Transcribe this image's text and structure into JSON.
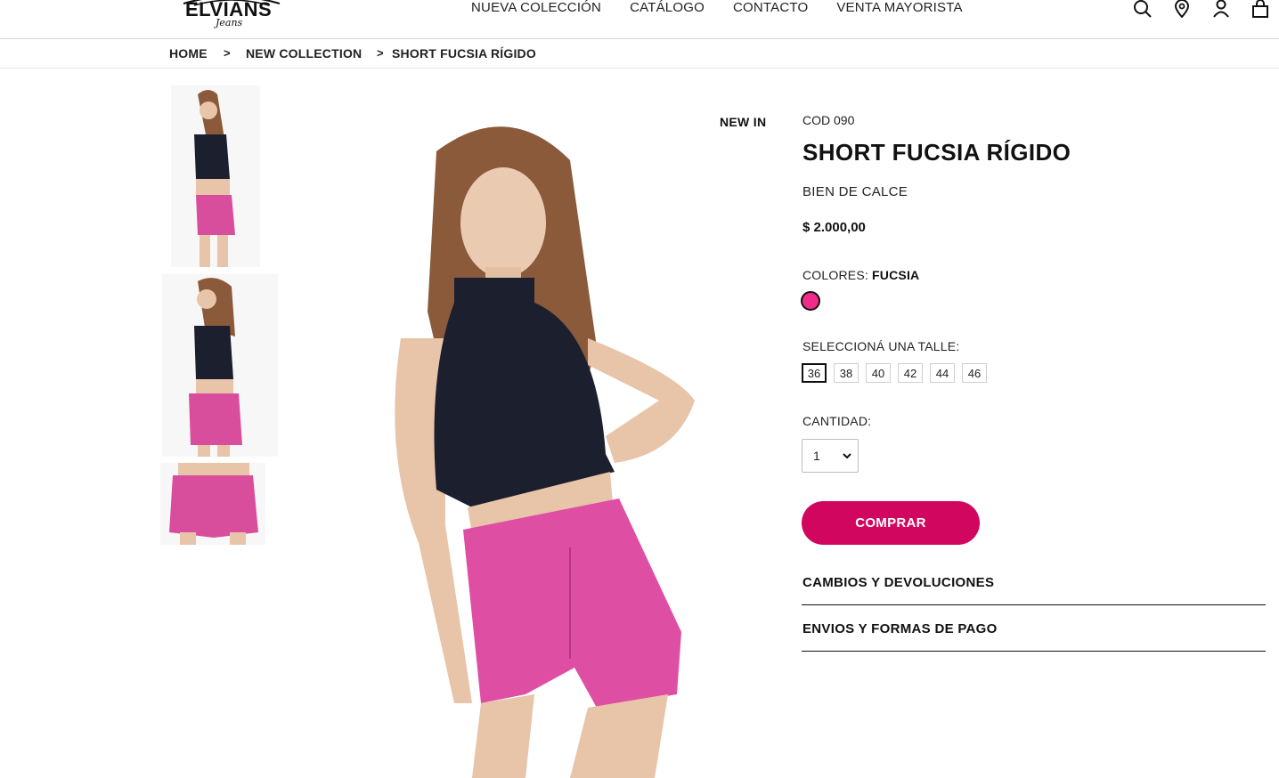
{
  "brand": {
    "name": "ELVIANS",
    "tagline": "Jeans"
  },
  "nav": [
    {
      "label": "NUEVA COLECCIÓN"
    },
    {
      "label": "CATÁLOGO"
    },
    {
      "label": "CONTACTO"
    },
    {
      "label": "VENTA MAYORISTA"
    }
  ],
  "header_icons": [
    "search-icon",
    "location-pin-icon",
    "user-icon",
    "shopping-bag-icon"
  ],
  "breadcrumb": {
    "items": [
      "HOME",
      "NEW COLLECTION",
      "SHORT FUCSIA RÍGIDO"
    ],
    "separator": ">"
  },
  "gallery": {
    "badge": "NEW IN"
  },
  "product": {
    "code": "COD 090",
    "title": "SHORT FUCSIA RÍGIDO",
    "subtitle": "BIEN DE CALCE",
    "price": "$ 2.000,00",
    "colors_label": "COLORES: ",
    "selected_color": "FUCSIA",
    "swatch_color": "#f02c88",
    "size_label": "SELECCIONÁ UNA TALLE:",
    "sizes": [
      "36",
      "38",
      "40",
      "42",
      "44",
      "46"
    ],
    "selected_size": "36",
    "quantity_label": "CANTIDAD:",
    "quantity": "1",
    "buy_label": "COMPRAR",
    "accent_color": "#d1065f"
  },
  "accordions": [
    {
      "label": "CAMBIOS Y DEVOLUCIONES"
    },
    {
      "label": "ENVIOS Y FORMAS DE PAGO"
    }
  ]
}
